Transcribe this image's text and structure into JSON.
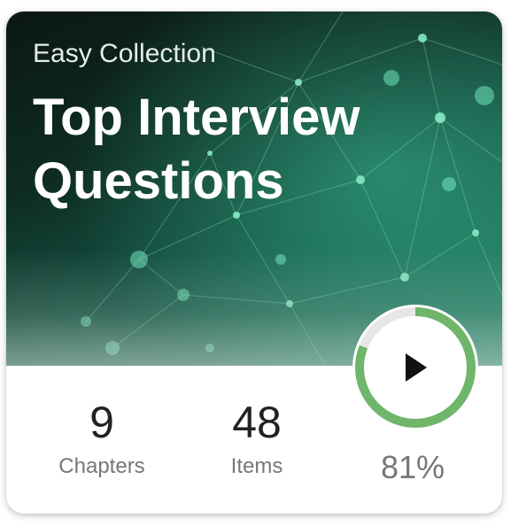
{
  "card": {
    "subtitle": "Easy Collection",
    "title": "Top Interview Questions"
  },
  "stats": {
    "chapters": {
      "value": "9",
      "label": "Chapters"
    },
    "items": {
      "value": "48",
      "label": "Items"
    }
  },
  "progress": {
    "percent": 81,
    "label": "81%",
    "ring_color": "#6fb56a",
    "track_color": "#e6e6e6"
  },
  "icons": {
    "play": "play-icon"
  }
}
